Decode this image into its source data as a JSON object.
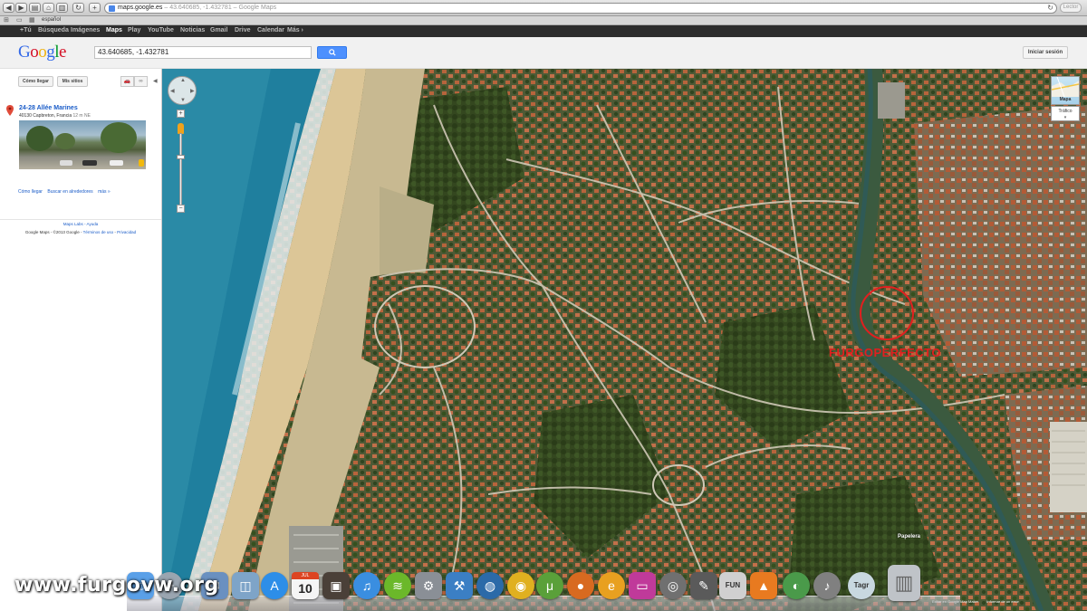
{
  "browser": {
    "url_host": "maps.google.es",
    "url_rest": " – 43.640685, -1.432781 – Google Maps",
    "reader_label": "Lector",
    "bookmark_label": "español"
  },
  "gbar": {
    "items": [
      {
        "label": "+Tú",
        "active": false
      },
      {
        "label": "Búsqueda",
        "active": false
      },
      {
        "label": "Imágenes",
        "active": false
      },
      {
        "label": "Maps",
        "active": true
      },
      {
        "label": "Play",
        "active": false
      },
      {
        "label": "YouTube",
        "active": false
      },
      {
        "label": "Noticias",
        "active": false
      },
      {
        "label": "Gmail",
        "active": false
      },
      {
        "label": "Drive",
        "active": false
      },
      {
        "label": "Calendar",
        "active": false
      },
      {
        "label": "Más ›",
        "active": false
      }
    ]
  },
  "header": {
    "logo_letters": [
      {
        "ch": "G",
        "color": "#3369e8"
      },
      {
        "ch": "o",
        "color": "#d50f25"
      },
      {
        "ch": "o",
        "color": "#eeb211"
      },
      {
        "ch": "g",
        "color": "#3369e8"
      },
      {
        "ch": "l",
        "color": "#009925"
      },
      {
        "ch": "e",
        "color": "#d50f25"
      }
    ],
    "search_value": "43.640685, -1.432781",
    "signin_label": "Iniciar sesión"
  },
  "panel": {
    "directions_label": "Cómo llegar",
    "my_places_label": "Mis sitios",
    "place_title": "24-28 Allée Marines",
    "place_address": "40130 Capbreton, Francia",
    "place_distance": "12 m NE",
    "links": [
      "Cómo llegar",
      "Buscar en alrededores",
      "más »"
    ],
    "footer_links": "Maps Labs - Ayuda",
    "copyright": "Google Maps - ©2013 Google - ",
    "terms": "Términos de uso",
    "privacy": "Privacidad"
  },
  "map": {
    "maptype_label": "Mapa",
    "traffic_label": "Tráfico",
    "annotation_label": "FURGOPERFECTO",
    "poi_label": "Papelera",
    "footer": [
      "Editar en Google Map Maker",
      "Informar de un error"
    ],
    "colors": {
      "annotation": "#e11f1f",
      "sea": "#2a8aa6",
      "sand": "#d8c394",
      "vegetation": "#3f5a2a"
    }
  },
  "dock": {
    "calendar_month": "JUL",
    "calendar_day": "10",
    "icons": [
      "finder-icon",
      "launchpad-icon",
      "mail-icon",
      "preview-icon",
      "app-store-icon",
      "calendar-icon",
      "photo-icon",
      "itunes-icon",
      "spotify-icon",
      "system-preferences-icon",
      "xcode-icon",
      "google-earth-icon",
      "chrome-icon",
      "utorrent-icon",
      "firefox-icon",
      "cyberduck-icon",
      "monitor-icon",
      "disk-utility-icon",
      "textmate-icon",
      "filezilla-icon",
      "vlc-icon",
      "growl-icon",
      "audio-icon",
      "tagr-icon",
      "trash-icon"
    ]
  },
  "watermark": "www.furgovw.org"
}
